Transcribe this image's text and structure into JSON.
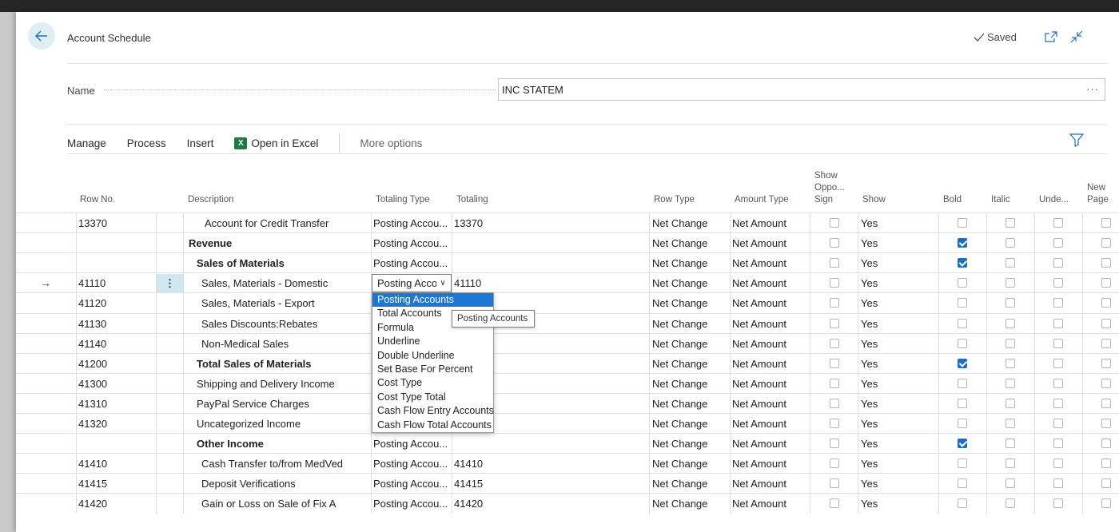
{
  "header": {
    "title": "Account Schedule",
    "saved": "Saved"
  },
  "name_field": {
    "label": "Name",
    "value": "INC STATEM",
    "more": "···"
  },
  "actions": {
    "manage": "Manage",
    "process": "Process",
    "insert": "Insert",
    "open_excel": "Open in Excel",
    "excel_glyph": "X",
    "more_options": "More options"
  },
  "columns": {
    "row_no": "Row No.",
    "description": "Description",
    "totaling_type": "Totaling Type",
    "totaling": "Totaling",
    "row_type": "Row Type",
    "amount_type": "Amount Type",
    "show_opp_1": "Show",
    "show_opp_2": "Oppo...",
    "show_opp_3": "Sign",
    "show": "Show",
    "bold": "Bold",
    "italic": "Italic",
    "underline": "Unde...",
    "new_page_1": "New",
    "new_page_2": "Page"
  },
  "rows": [
    {
      "no": "13370",
      "desc": "Account for Credit Transfer",
      "indent": 3,
      "bold": false,
      "ttype": "Posting Accou...",
      "totaling": "13370",
      "rtype": "Net Change",
      "atype": "Net Amount",
      "show": "Yes",
      "bold_check": false
    },
    {
      "no": "",
      "desc": "Revenue",
      "indent": 1,
      "bold": true,
      "ttype": "Posting Accou...",
      "totaling": "",
      "rtype": "Net Change",
      "atype": "Net Amount",
      "show": "Yes",
      "bold_check": true
    },
    {
      "no": "",
      "desc": "Sales of Materials",
      "indent": 2,
      "bold": true,
      "ttype": "Posting Accou...",
      "totaling": "",
      "rtype": "Net Change",
      "atype": "Net Amount",
      "show": "Yes",
      "bold_check": true
    },
    {
      "no": "41110",
      "desc": "Sales, Materials - Domestic",
      "indent": 2.6,
      "bold": false,
      "ttype": "Posting Acco",
      "totaling": "41110",
      "rtype": "Net Change",
      "atype": "Net Amount",
      "show": "Yes",
      "bold_check": false
    },
    {
      "no": "41120",
      "desc": "Sales, Materials - Export",
      "indent": 2.6,
      "bold": false,
      "ttype": "",
      "totaling": "",
      "rtype": "Net Change",
      "atype": "Net Amount",
      "show": "Yes",
      "bold_check": false
    },
    {
      "no": "41130",
      "desc": "Sales Discounts:Rebates",
      "indent": 2.6,
      "bold": false,
      "ttype": "",
      "totaling": "",
      "rtype": "Net Change",
      "atype": "Net Amount",
      "show": "Yes",
      "bold_check": false
    },
    {
      "no": "41140",
      "desc": "Non-Medical Sales",
      "indent": 2.6,
      "bold": false,
      "ttype": "",
      "totaling": "",
      "rtype": "Net Change",
      "atype": "Net Amount",
      "show": "Yes",
      "bold_check": false
    },
    {
      "no": "41200",
      "desc": "Total Sales of Materials",
      "indent": 2,
      "bold": true,
      "ttype": "",
      "totaling": "",
      "rtype": "Net Change",
      "atype": "Net Amount",
      "show": "Yes",
      "bold_check": true
    },
    {
      "no": "41300",
      "desc": "Shipping and Delivery Income",
      "indent": 2,
      "bold": false,
      "ttype": "",
      "totaling": "",
      "rtype": "Net Change",
      "atype": "Net Amount",
      "show": "Yes",
      "bold_check": false
    },
    {
      "no": "41310",
      "desc": "PayPal Service Charges",
      "indent": 2,
      "bold": false,
      "ttype": "",
      "totaling": "",
      "rtype": "Net Change",
      "atype": "Net Amount",
      "show": "Yes",
      "bold_check": false
    },
    {
      "no": "41320",
      "desc": "Uncategorized Income",
      "indent": 2,
      "bold": false,
      "ttype": "",
      "totaling": "",
      "rtype": "Net Change",
      "atype": "Net Amount",
      "show": "Yes",
      "bold_check": false
    },
    {
      "no": "",
      "desc": "Other Income",
      "indent": 2,
      "bold": true,
      "ttype": "Posting Accou...",
      "totaling": "",
      "rtype": "Net Change",
      "atype": "Net Amount",
      "show": "Yes",
      "bold_check": true
    },
    {
      "no": "41410",
      "desc": "Cash Transfer to/from MedVed",
      "indent": 2.6,
      "bold": false,
      "ttype": "Posting Accou...",
      "totaling": "41410",
      "rtype": "Net Change",
      "atype": "Net Amount",
      "show": "Yes",
      "bold_check": false
    },
    {
      "no": "41415",
      "desc": "Deposit Verifications",
      "indent": 2.6,
      "bold": false,
      "ttype": "Posting Accou...",
      "totaling": "41415",
      "rtype": "Net Change",
      "atype": "Net Amount",
      "show": "Yes",
      "bold_check": false
    },
    {
      "no": "41420",
      "desc": "Gain or Loss on Sale of Fix A",
      "indent": 2.6,
      "bold": false,
      "ttype": "Posting Accou...",
      "totaling": "41420",
      "rtype": "Net Change",
      "atype": "Net Amount",
      "show": "Yes",
      "bold_check": false
    }
  ],
  "dropdown": {
    "options": [
      "Posting Accounts",
      "Total Accounts",
      "Formula",
      "Underline",
      "Double Underline",
      "Set Base For Percent",
      "Cost Type",
      "Cost Type Total",
      "Cash Flow Entry Accounts",
      "Cash Flow Total Accounts"
    ],
    "selected": "Posting Accounts",
    "tooltip": "Posting Accounts"
  },
  "colors": {
    "accent": "#1c6ec1",
    "selection": "#cfe7ee"
  }
}
